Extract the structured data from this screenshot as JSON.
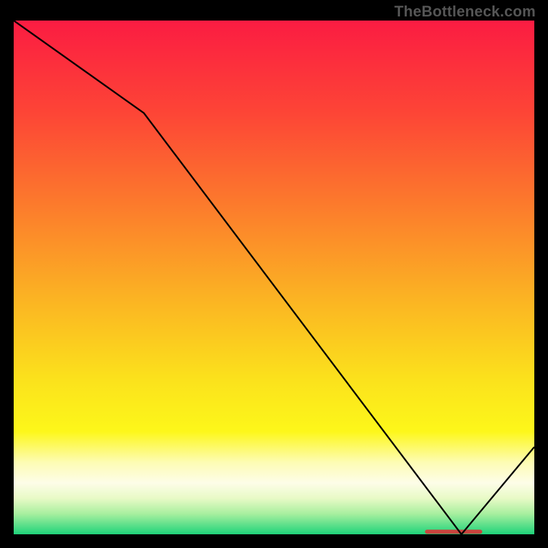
{
  "watermark": "TheBottleneck.com",
  "chart_data": {
    "type": "line",
    "title": "",
    "xlabel": "",
    "ylabel": "",
    "x": [
      0,
      25,
      86,
      100
    ],
    "values": [
      100,
      82,
      0,
      17
    ],
    "xlim": [
      0,
      100
    ],
    "ylim": [
      0,
      100
    ],
    "annotations": [
      {
        "x_start": 79,
        "x_end": 90,
        "y": 0.5,
        "color": "#c9443e"
      }
    ],
    "gradient_stops": [
      {
        "offset": 0,
        "color": "#fb1c42"
      },
      {
        "offset": 18,
        "color": "#fd4536"
      },
      {
        "offset": 36,
        "color": "#fc7b2c"
      },
      {
        "offset": 54,
        "color": "#fbb323"
      },
      {
        "offset": 70,
        "color": "#fbe21c"
      },
      {
        "offset": 80,
        "color": "#fdf71a"
      },
      {
        "offset": 86,
        "color": "#fdfcb4"
      },
      {
        "offset": 90,
        "color": "#fdfde8"
      },
      {
        "offset": 93,
        "color": "#e8fac6"
      },
      {
        "offset": 96,
        "color": "#a8ef9f"
      },
      {
        "offset": 100,
        "color": "#1fd37a"
      }
    ],
    "line_color": "#000000"
  }
}
